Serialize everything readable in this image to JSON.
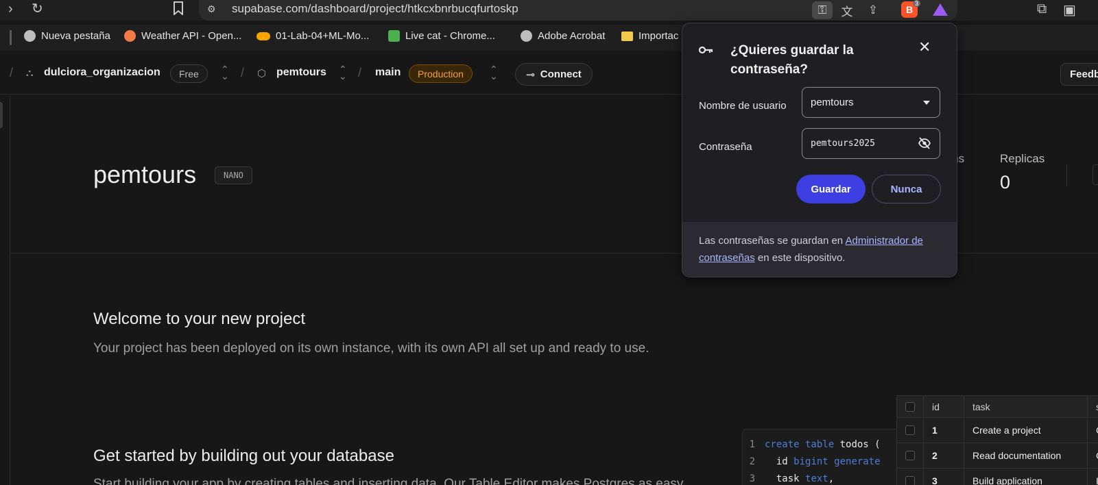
{
  "browser": {
    "url": "supabase.com/dashboard/project/htkcxbnrbucqfurtoskp",
    "brave_shield_count": "3",
    "bookmarks": [
      {
        "label": "Nueva pestaña",
        "color": "#bdbdbd"
      },
      {
        "label": "Weather API - Open...",
        "color": "#f27b4a"
      },
      {
        "label": "01-Lab-04+ML-Mo...",
        "color": "#f7a600"
      },
      {
        "label": "Live cat - Chrome...",
        "color": "#4caf50"
      },
      {
        "label": "Adobe Acrobat",
        "color": "#bdbdbd"
      },
      {
        "label": "Importac",
        "color": "#f2c94c"
      }
    ]
  },
  "header": {
    "org_name": "dulciora_organizacion",
    "org_plan": "Free",
    "project_name": "pemtours",
    "branch": "main",
    "env_badge": "Production",
    "connect_label": "Connect",
    "feedback_label": "Feedb"
  },
  "main": {
    "project_title": "pemtours",
    "compute_badge": "NANO",
    "stats": [
      {
        "label": "ions",
        "value": ""
      },
      {
        "label": "Replicas",
        "value": "0"
      }
    ],
    "welcome_title": "Welcome to your new project",
    "welcome_sub": "Your project has been deployed on its own instance, with its own API all set up and ready to use.",
    "db_title": "Get started by building out your database",
    "db_sub": "Start building your app by creating tables and inserting data. Our Table Editor makes Postgres as easy"
  },
  "code": [
    {
      "n": "1",
      "kw": "create table",
      "rest": " todos ("
    },
    {
      "n": "2",
      "pre": "  id ",
      "kw": "bigint generate",
      "rest": ""
    },
    {
      "n": "3",
      "pre": "  task ",
      "kw": "text",
      "rest": ","
    }
  ],
  "table": {
    "headers": [
      "id",
      "task",
      "s"
    ],
    "rows": [
      [
        "1",
        "Create a project",
        "C"
      ],
      [
        "2",
        "Read documentation",
        "C"
      ],
      [
        "3",
        "Build application",
        "I"
      ]
    ]
  },
  "dialog": {
    "title": "¿Quieres guardar la contraseña?",
    "username_label": "Nombre de usuario",
    "username_value": "pemtours",
    "password_label": "Contraseña",
    "password_value": "pemtours2025",
    "save_label": "Guardar",
    "never_label": "Nunca",
    "footer_prefix": "Las contraseñas se guardan en ",
    "footer_link": "Administrador de contraseñas",
    "footer_suffix": " en este dispositivo."
  }
}
